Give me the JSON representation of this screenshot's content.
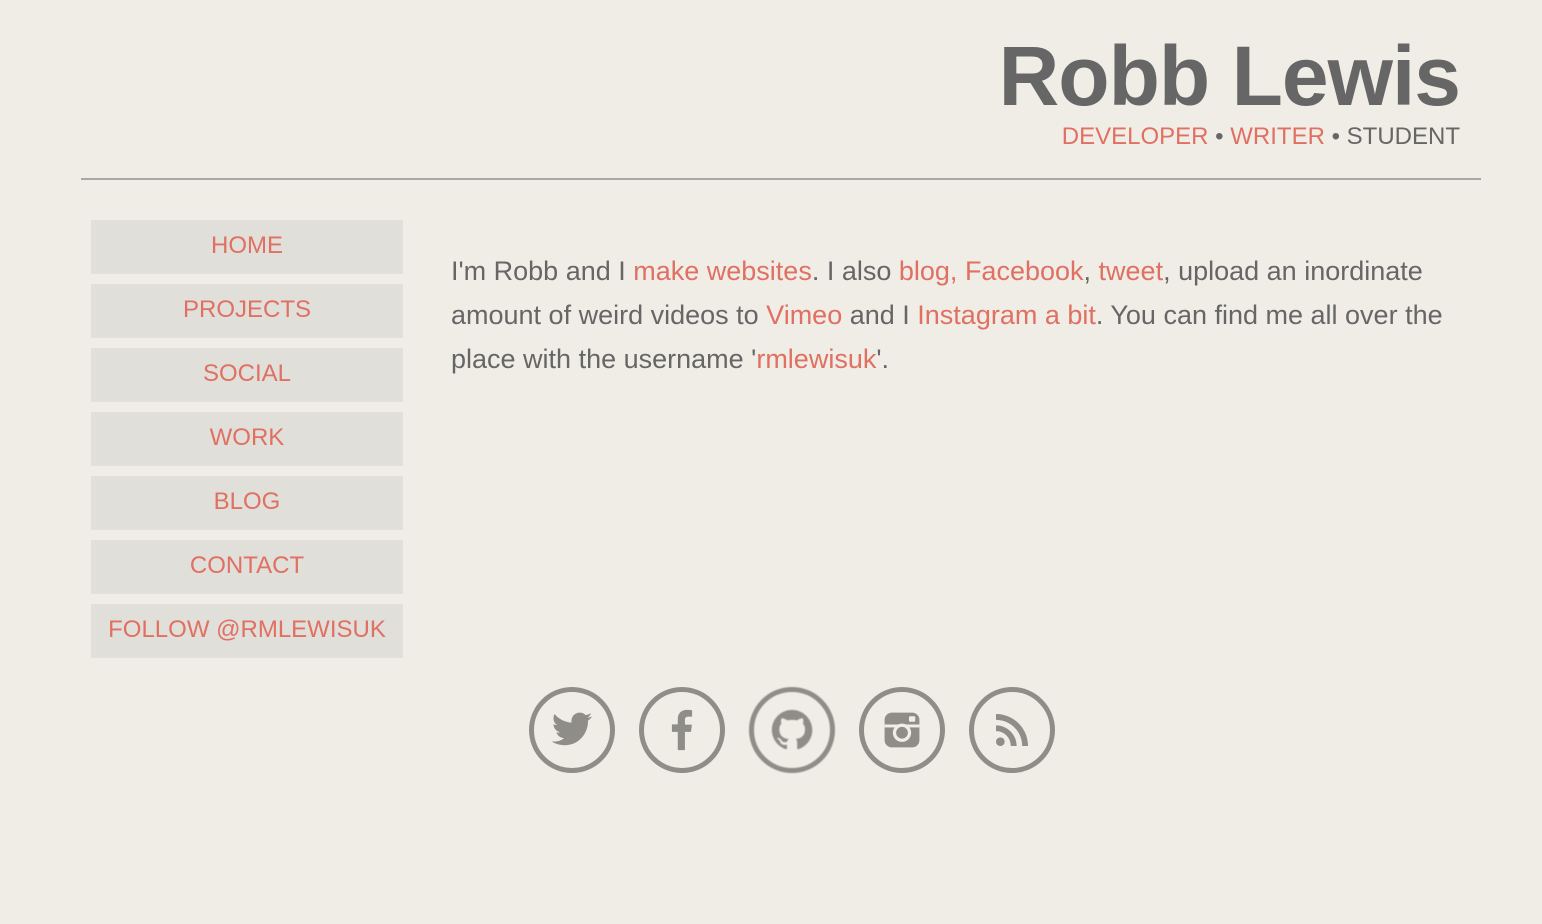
{
  "header": {
    "title": "Robb Lewis",
    "tagline": {
      "developer": "DEVELOPER",
      "sep1": " • ",
      "writer": "WRITER",
      "sep2": " • ",
      "student": "STUDENT"
    }
  },
  "nav": {
    "items": [
      {
        "label": "HOME"
      },
      {
        "label": "PROJECTS"
      },
      {
        "label": "SOCIAL"
      },
      {
        "label": "WORK"
      },
      {
        "label": "BLOG"
      },
      {
        "label": "CONTACT"
      },
      {
        "label": "FOLLOW @RMLEWISUK"
      }
    ]
  },
  "intro": {
    "t1": "I'm Robb and I ",
    "link_websites": "make websites",
    "t2": ". I also ",
    "link_blog": "blog, ",
    "link_facebook": "Facebook",
    "t3": ", ",
    "link_tweet": "tweet",
    "t4": ", upload an inordinate amount of weird videos to ",
    "link_vimeo": "Vimeo",
    "t5": " and I ",
    "link_instagram": "Instagram a bit",
    "t6": ". You can find me all over the place with the username '",
    "link_username": "rmlewisuk",
    "t7": "'."
  },
  "social": {
    "icons": [
      "twitter-icon",
      "facebook-icon",
      "github-icon",
      "instagram-icon",
      "rss-icon"
    ]
  },
  "colors": {
    "background": "#f0ede6",
    "accent": "#e07062",
    "text": "#666666",
    "nav_bg": "#e1dfd9",
    "icon": "#8e8d88"
  }
}
